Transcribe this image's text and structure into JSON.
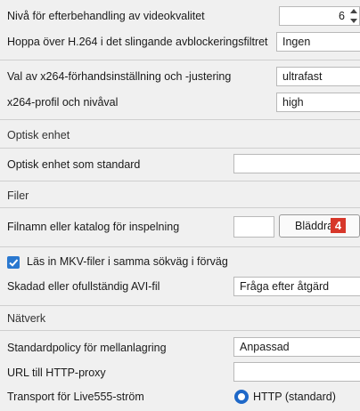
{
  "video": {
    "postproc_label": "Nivå för efterbehandling av videokvalitet",
    "postproc_value": "6",
    "skip_loop_label": "Hoppa över H.264 i det slingande avblockeringsfiltret",
    "skip_loop_value": "Ingen",
    "x264_preset_label": "Val av x264-förhandsinställning och -justering",
    "x264_preset_value": "ultrafast",
    "x264_profile_label": "x264-profil och nivåval",
    "x264_profile_value": "high"
  },
  "optical": {
    "section_title": "Optisk enhet",
    "default_label": "Optisk enhet som standard",
    "default_value": ""
  },
  "files": {
    "section_title": "Filer",
    "record_label": "Filnamn eller katalog för inspelning",
    "record_value": "",
    "browse_label": "Bläddra...",
    "badge": "4",
    "mkv_checkbox_label": "Läs in MKV-filer i samma sökväg i förväg",
    "mkv_checked": true,
    "avi_label": "Skadad eller ofullständig AVI-fil",
    "avi_value": "Fråga efter åtgärd"
  },
  "network": {
    "section_title": "Nätverk",
    "cache_label": "Standardpolicy för mellanlagring",
    "cache_value": "Anpassad",
    "proxy_label": "URL till HTTP-proxy",
    "proxy_value": "",
    "transport_label": "Transport för Live555-ström",
    "transport_option": "HTTP (standard)"
  },
  "colors": {
    "accent": "#1e68c8",
    "badge": "#d7372a"
  }
}
